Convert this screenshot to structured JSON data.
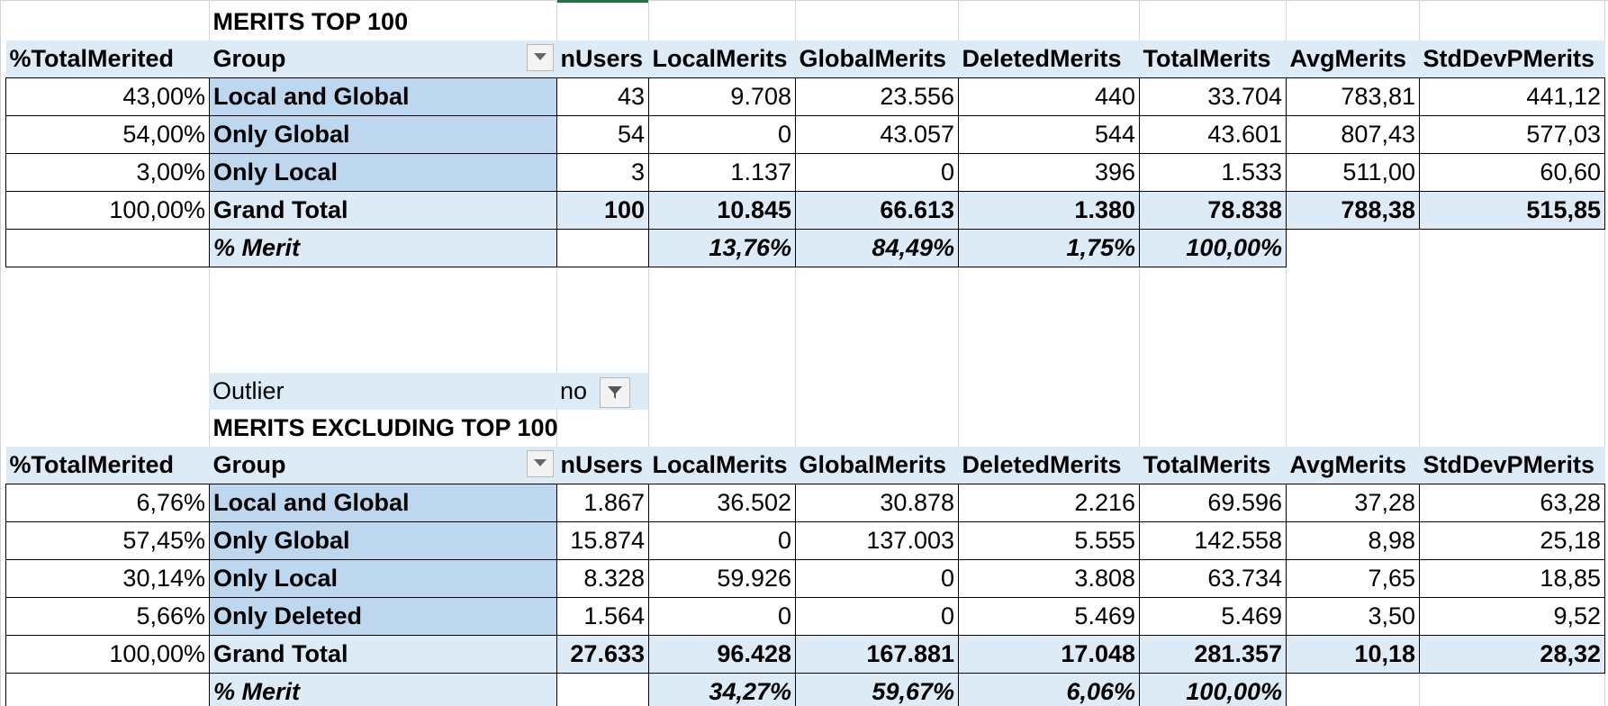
{
  "table1": {
    "title": "MERITS TOP 100",
    "headers": [
      "%TotalMerited",
      "Group",
      "nUsers",
      "LocalMerits",
      "GlobalMerits",
      "DeletedMerits",
      "TotalMerits",
      "AvgMerits",
      "StdDevPMerits"
    ],
    "rows": [
      [
        "43,00%",
        "Local and Global",
        "43",
        "9.708",
        "23.556",
        "440",
        "33.704",
        "783,81",
        "441,12"
      ],
      [
        "54,00%",
        "Only Global",
        "54",
        "0",
        "43.057",
        "544",
        "43.601",
        "807,43",
        "577,03"
      ],
      [
        "3,00%",
        "Only Local",
        "3",
        "1.137",
        "0",
        "396",
        "1.533",
        "511,00",
        "60,60"
      ]
    ],
    "total": [
      "100,00%",
      "Grand Total",
      "100",
      "10.845",
      "66.613",
      "1.380",
      "78.838",
      "788,38",
      "515,85"
    ],
    "merit": {
      "label": "% Merit",
      "values": [
        "13,76%",
        "84,49%",
        "1,75%",
        "100,00%"
      ]
    }
  },
  "filter": {
    "label": "Outlier",
    "value": "no"
  },
  "table2": {
    "title": "MERITS EXCLUDING TOP 100",
    "headers": [
      "%TotalMerited",
      "Group",
      "nUsers",
      "LocalMerits",
      "GlobalMerits",
      "DeletedMerits",
      "TotalMerits",
      "AvgMerits",
      "StdDevPMerits"
    ],
    "rows": [
      [
        "6,76%",
        "Local and Global",
        "1.867",
        "36.502",
        "30.878",
        "2.216",
        "69.596",
        "37,28",
        "63,28"
      ],
      [
        "57,45%",
        "Only Global",
        "15.874",
        "0",
        "137.003",
        "5.555",
        "142.558",
        "8,98",
        "25,18"
      ],
      [
        "30,14%",
        "Only Local",
        "8.328",
        "59.926",
        "0",
        "3.808",
        "63.734",
        "7,65",
        "18,85"
      ],
      [
        "5,66%",
        "Only Deleted",
        "1.564",
        "0",
        "0",
        "5.469",
        "5.469",
        "3,50",
        "9,52"
      ]
    ],
    "total": [
      "100,00%",
      "Grand Total",
      "27.633",
      "96.428",
      "167.881",
      "17.048",
      "281.357",
      "10,18",
      "28,32"
    ],
    "merit": {
      "label": "% Merit",
      "values": [
        "34,27%",
        "59,67%",
        "6,06%",
        "100,00%"
      ]
    }
  },
  "colors": {
    "header_fill": "#ddebf7",
    "group_fill": "#bdd7ee",
    "gridline": "#d4d4d4",
    "selection": "#217346"
  },
  "icons": {
    "dropdown": "chevron-down-icon",
    "filter": "filter-icon"
  }
}
